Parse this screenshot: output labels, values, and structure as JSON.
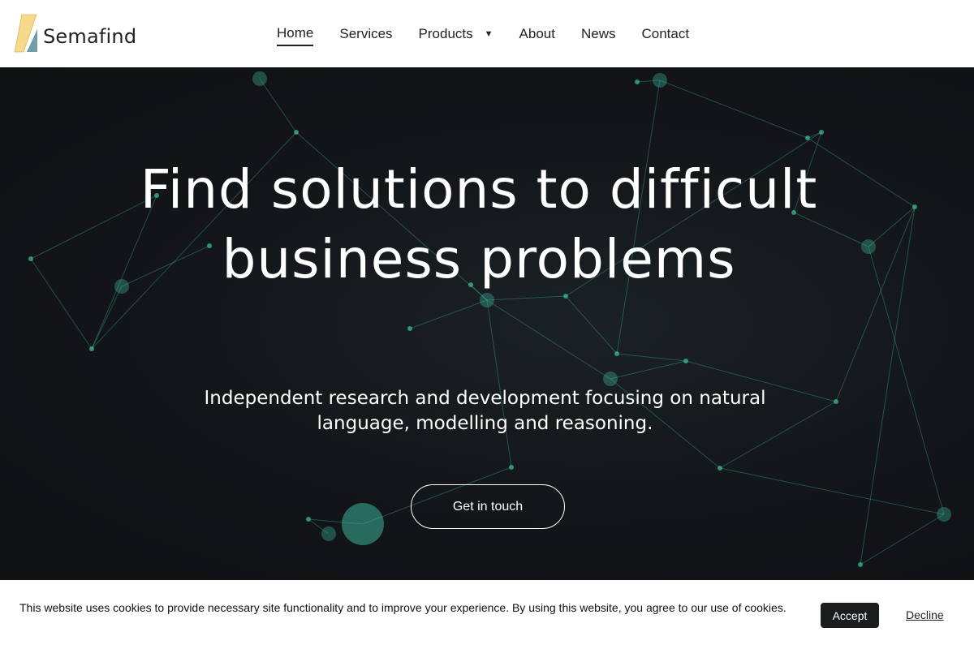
{
  "brand": {
    "name": "Semafind",
    "colors": {
      "yellow": "#f6d98a",
      "teal": "#6f9ea6"
    }
  },
  "nav": {
    "items": [
      {
        "label": "Home",
        "active": true
      },
      {
        "label": "Services"
      },
      {
        "label": "Products",
        "has_dropdown": true
      },
      {
        "label": "About"
      },
      {
        "label": "News"
      },
      {
        "label": "Contact"
      }
    ]
  },
  "hero": {
    "title_line1": "Find solutions to difficult",
    "title_line2": "business problems",
    "subtitle": "Independent research and development focusing on natural language, modelling and reasoning.",
    "cta_label": "Get in touch",
    "accent": "#3fbfa6"
  },
  "cookie": {
    "text": "This website uses cookies to provide necessary site functionality and to improve your experience. By using this website, you agree to our use of cookies.",
    "accept_label": "Accept",
    "decline_label": "Decline"
  }
}
